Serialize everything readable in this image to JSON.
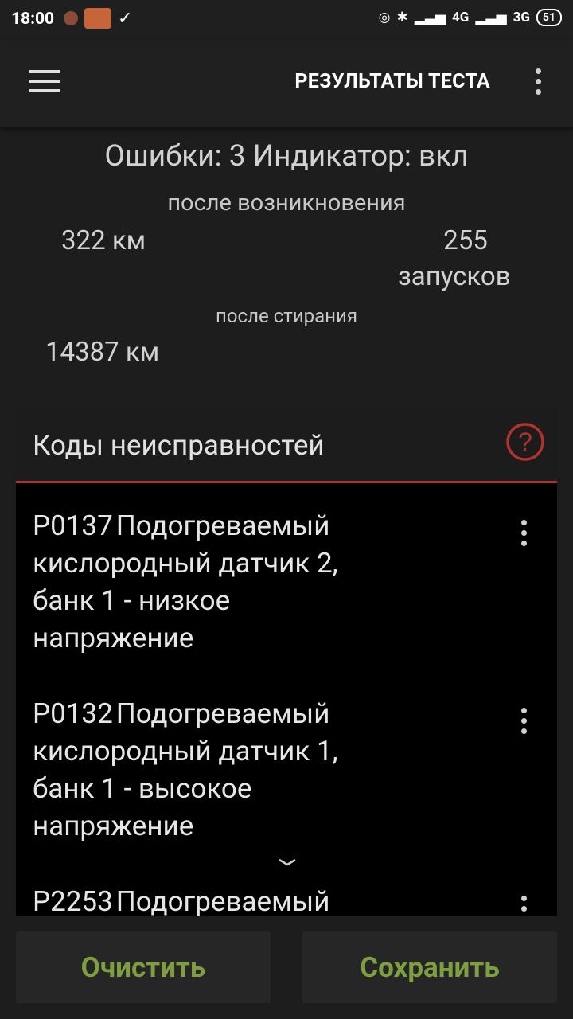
{
  "status_bar": {
    "time": "18:00",
    "network_1": "4G",
    "network_2": "3G",
    "battery": "51"
  },
  "toolbar": {
    "title": "РЕЗУЛЬТАТЫ ТЕСТА",
    "menu_icon": "hamburger-icon",
    "overflow_icon": "more-vert-icon"
  },
  "summary": {
    "title": "Ошибки: 3 Индикатор: вкл",
    "since_occurrence_label": "после возникновения",
    "since_occurrence_km": "322 км",
    "since_occurrence_starts_count": "255",
    "since_occurrence_starts_unit": "запусков",
    "since_clear_label": "после стирания",
    "since_clear_km": "14387 км"
  },
  "codes_panel": {
    "title": "Коды неисправностей",
    "help_icon": "help-circle-icon",
    "codes": [
      {
        "code": "P0137",
        "lines": [
          "Подогреваемый",
          "кислородный датчик 2,",
          "банк 1 - низкое",
          "напряжение"
        ]
      },
      {
        "code": "P0132",
        "lines": [
          "Подогреваемый",
          "кислородный датчик 1,",
          "банк 1 - высокое",
          "напряжение"
        ]
      },
      {
        "code": "P2253",
        "lines": [
          "Подогреваемый"
        ]
      }
    ]
  },
  "buttons": {
    "clear": "Очистить",
    "save": "Сохранить"
  },
  "colors": {
    "accent_red": "#b3312d",
    "button_text_green": "#7e9f3f",
    "background": "#1d1d1d",
    "panel_bg": "#000000"
  }
}
